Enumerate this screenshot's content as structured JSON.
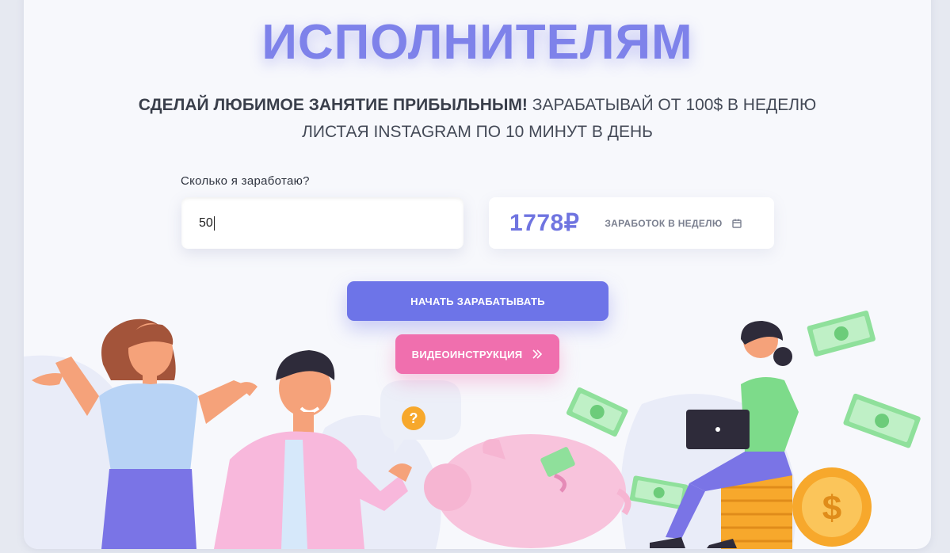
{
  "hero": {
    "title": "ИСПОЛНИТЕЛЯМ",
    "subtitle_bold": "СДЕЛАЙ ЛЮБИМОЕ ЗАНЯТИЕ ПРИБЫЛЬНЫМ!",
    "subtitle_rest": " ЗАРАБАТЫВАЙ ОТ 100$ В НЕДЕЛЮ",
    "subtitle_line2": "ЛИСТАЯ INSTAGRAM ПО 10 МИНУТ В ДЕНЬ"
  },
  "calculator": {
    "label": "Сколько я заработаю?",
    "input_value": "50",
    "result_value": "1778₽",
    "result_label": "ЗАРАБОТОК В НЕДЕЛЮ",
    "result_icon": "calendar-icon"
  },
  "actions": {
    "primary_label": "НАЧАТЬ ЗАРАБАТЫВАТЬ",
    "video_label": "ВИДЕОИНСТРУКЦИЯ",
    "video_icon": "double-chevron-right-icon"
  },
  "illustration": {
    "question_mark": "?",
    "coin_symbol": "$",
    "bill_symbol": "$"
  },
  "colors": {
    "accent": "#6d74e8",
    "title": "#7e82ea",
    "pink": "#f06fae",
    "money_green": "#7ddb8a",
    "coin_orange": "#f7a82c"
  }
}
